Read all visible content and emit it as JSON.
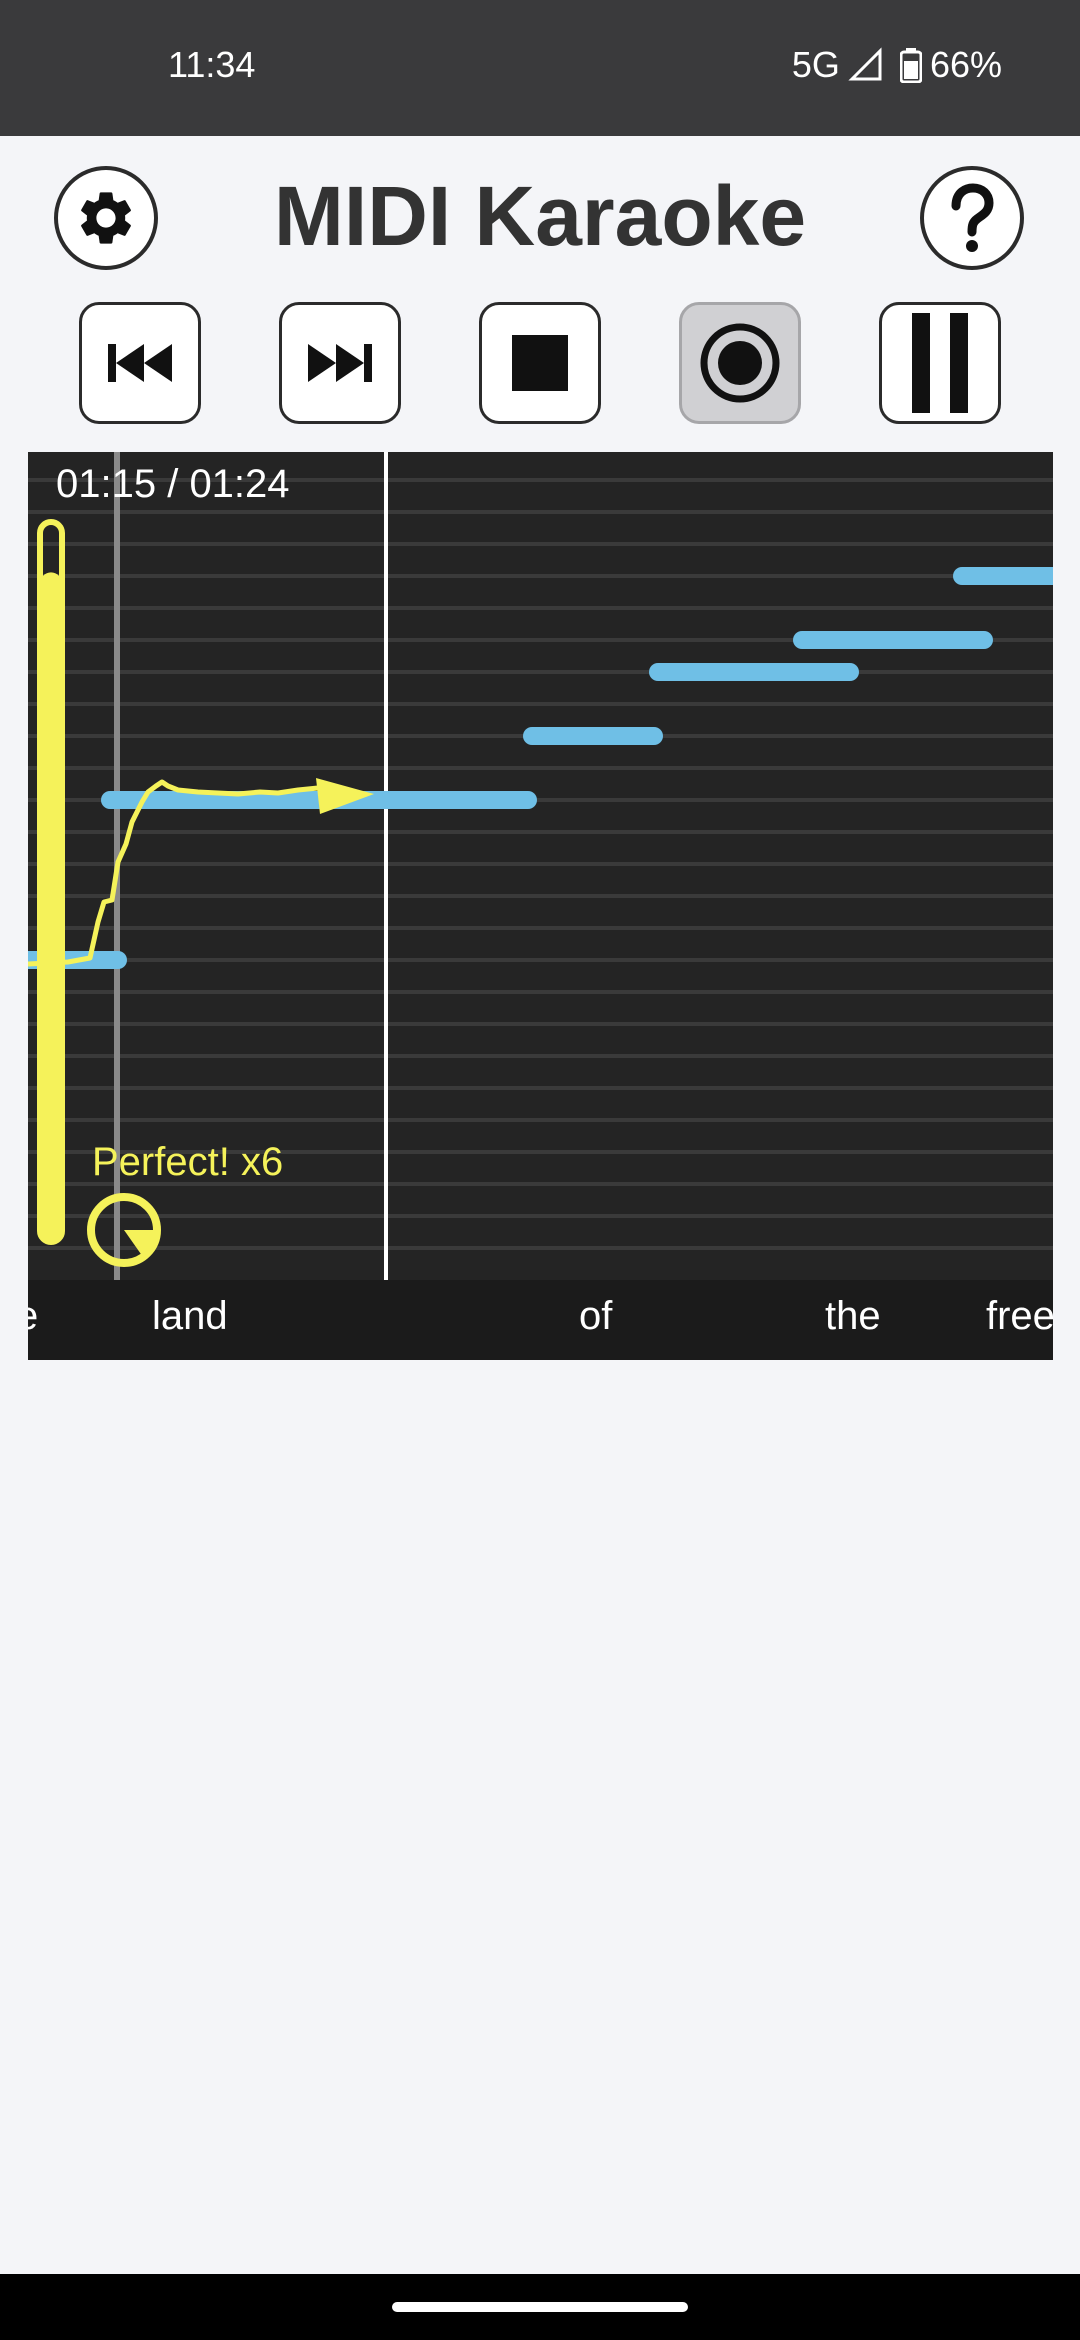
{
  "status_bar": {
    "time": "11:34",
    "network": "5G",
    "battery": "66%"
  },
  "header": {
    "title": "MIDI Karaoke",
    "settings_icon": "gear-icon",
    "help_icon": "question-icon"
  },
  "controls": [
    {
      "name": "skip-back-button",
      "icon": "skip-previous-icon"
    },
    {
      "name": "skip-forward-button",
      "icon": "skip-next-icon"
    },
    {
      "name": "stop-button",
      "icon": "stop-icon"
    },
    {
      "name": "record-button",
      "icon": "record-icon",
      "active": true
    },
    {
      "name": "pause-button",
      "icon": "pause-icon"
    }
  ],
  "player": {
    "time": "01:15 / 01:24",
    "judgement": "Perfect! x6",
    "volume_level": 0.93,
    "colors": {
      "background": "#242424",
      "note": "#6fbfe6",
      "pitch": "#f5f25a",
      "grid": "#3a3a3a"
    }
  },
  "lyrics": [
    "land",
    "of",
    "the",
    "free"
  ]
}
